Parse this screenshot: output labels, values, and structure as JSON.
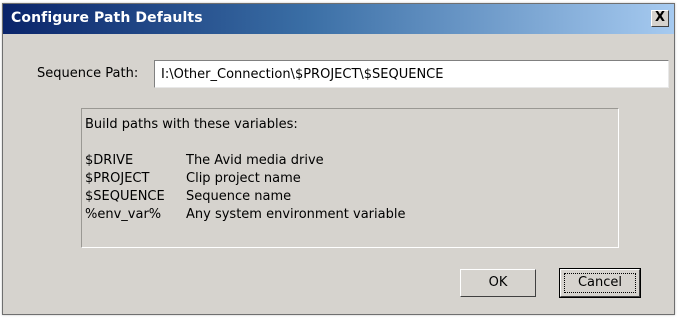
{
  "window": {
    "title": "Configure Path Defaults",
    "close_glyph": "X"
  },
  "sequence_path": {
    "label": "Sequence Path:",
    "value": "I:\\Other_Connection\\$PROJECT\\$SEQUENCE"
  },
  "variables": {
    "heading": "Build paths with these variables:",
    "items": [
      {
        "name": "$DRIVE",
        "description": "The Avid media drive"
      },
      {
        "name": "$PROJECT",
        "description": "Clip project name"
      },
      {
        "name": "$SEQUENCE",
        "description": "Sequence name"
      },
      {
        "name": "%env_var%",
        "description": "Any system environment variable"
      }
    ]
  },
  "buttons": {
    "ok_label": "OK",
    "cancel_label": "Cancel"
  },
  "colors": {
    "titlebar_start": "#0a246a",
    "titlebar_end": "#a6caf0",
    "dialog_face": "#d6d3ce"
  }
}
